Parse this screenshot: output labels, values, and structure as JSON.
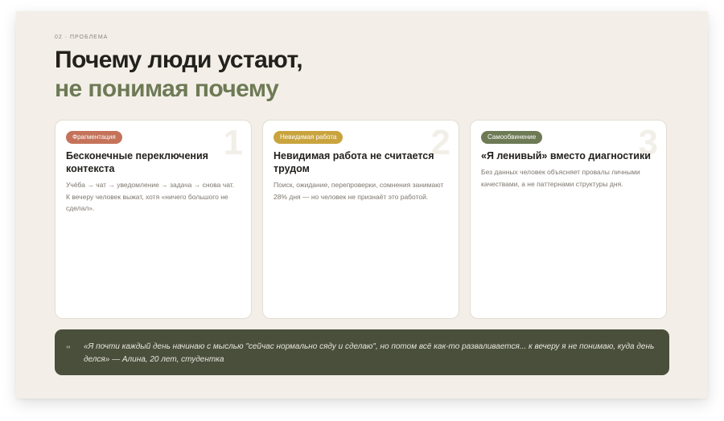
{
  "section": {
    "eyebrow": "02 · ПРОБЛЕМА"
  },
  "headline": {
    "line1": "Почему люди устают,",
    "line2": "не понимая почему"
  },
  "colors": {
    "background": "#f3efe8",
    "accent_green": "#6d7a55",
    "quote_bg": "#4a4f3c"
  },
  "cards": [
    {
      "number": "1",
      "badge": "Фрагментация",
      "badge_color": "#c4735a",
      "title": "Бесконечные переключения контекста",
      "text": "Учёба → чат → уведомление → задача → снова чат. К вечеру человек выжат, хотя «ничего большого не сделал»."
    },
    {
      "number": "2",
      "badge": "Невидимая работа",
      "badge_color": "#c9a43e",
      "title": "Невидимая работа не считается трудом",
      "text": "Поиск, ожидание, перепроверки, сомнения занимают 28% дня — но человек не признаёт это работой."
    },
    {
      "number": "3",
      "badge": "Самообвинение",
      "badge_color": "#6d7a55",
      "title": "«Я ленивый» вместо диагностики",
      "text": "Без данных человек объясняет провалы личными качествами, а не паттернами структуры дня."
    }
  ],
  "quote": {
    "mark": "\"",
    "text": "«Я почти каждый день начинаю с мыслью \"сейчас нормально сяду и сделаю\", но потом всё как-то разваливается... к вечеру я не понимаю, куда день делся» — Алина, 20 лет, студентка"
  }
}
